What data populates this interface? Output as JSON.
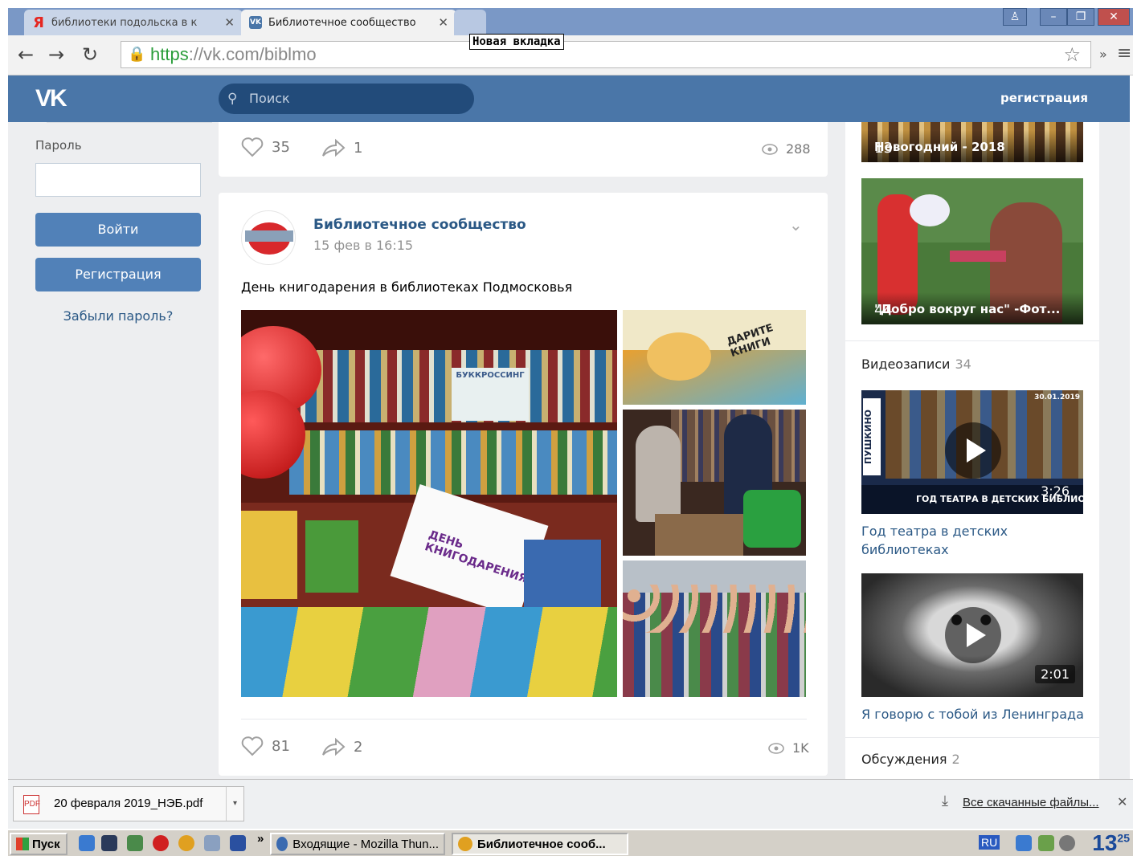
{
  "browser": {
    "tabs": [
      {
        "title": "библиотеки подольска в к",
        "icon": "yandex-icon",
        "close": "✕"
      },
      {
        "title": "Библиотечное сообществo",
        "icon": "vk-icon",
        "close": "✕"
      }
    ],
    "new_tab_tooltip": "Новая вкладка",
    "url_scheme": "https",
    "url_rest": "://vk.com/biblmo",
    "extension_chevron": "»"
  },
  "vk_header": {
    "logo": "VK",
    "search_placeholder": "Поиск",
    "register_link": "регистрация"
  },
  "login": {
    "password_label": "Пароль",
    "login_button": "Войти",
    "register_button": "Регистрация",
    "forgot_link": "Забыли пароль?"
  },
  "prev_post": {
    "likes": "35",
    "shares": "1",
    "views": "288"
  },
  "post": {
    "author": "Библиотечное сообщество",
    "date": "15 фев в 16:15",
    "text": "День книгодарения в библиотеках Подмосковья",
    "photo_texts": {
      "shelf_sign": "БУККРОССИНГ",
      "day_sign": "ДЕНЬ КНИГОДАРЕНИЯ",
      "dari_sign": "ДАРИТЕ КНИГИ"
    },
    "likes": "81",
    "shares": "2",
    "views": "1K"
  },
  "sidebar": {
    "albums": [
      {
        "title": "Новогодний - 2018",
        "count": "13"
      },
      {
        "title": "\"Добро вокруг нас\" -Фот...",
        "count": "44"
      }
    ],
    "videos_label": "Видеозаписи",
    "videos_count": "34",
    "videos": [
      {
        "title": "Год театра в детских библиотеках",
        "duration": "3:26",
        "overlay": "ГОД ТЕАТРА В ДЕТСКИХ БИБЛИОТЕКАХ",
        "badge": "ПУШКИНО",
        "date": "30.01.2019"
      },
      {
        "title": "Я говорю с тобой из Ленинграда",
        "duration": "2:01"
      }
    ],
    "discussions_label": "Обсуждения",
    "discussions_count": "2"
  },
  "downloads": {
    "file": "20 февраля 2019_НЭБ.pdf",
    "all_link": "Все скачанные файлы...",
    "close": "✕"
  },
  "taskbar": {
    "start": "Пуск",
    "items": [
      "Входящие - Mozilla Thun...",
      "Библиотечное сооб..."
    ],
    "lang": "RU",
    "clock": "13",
    "clock_small": "25",
    "more": "»"
  }
}
